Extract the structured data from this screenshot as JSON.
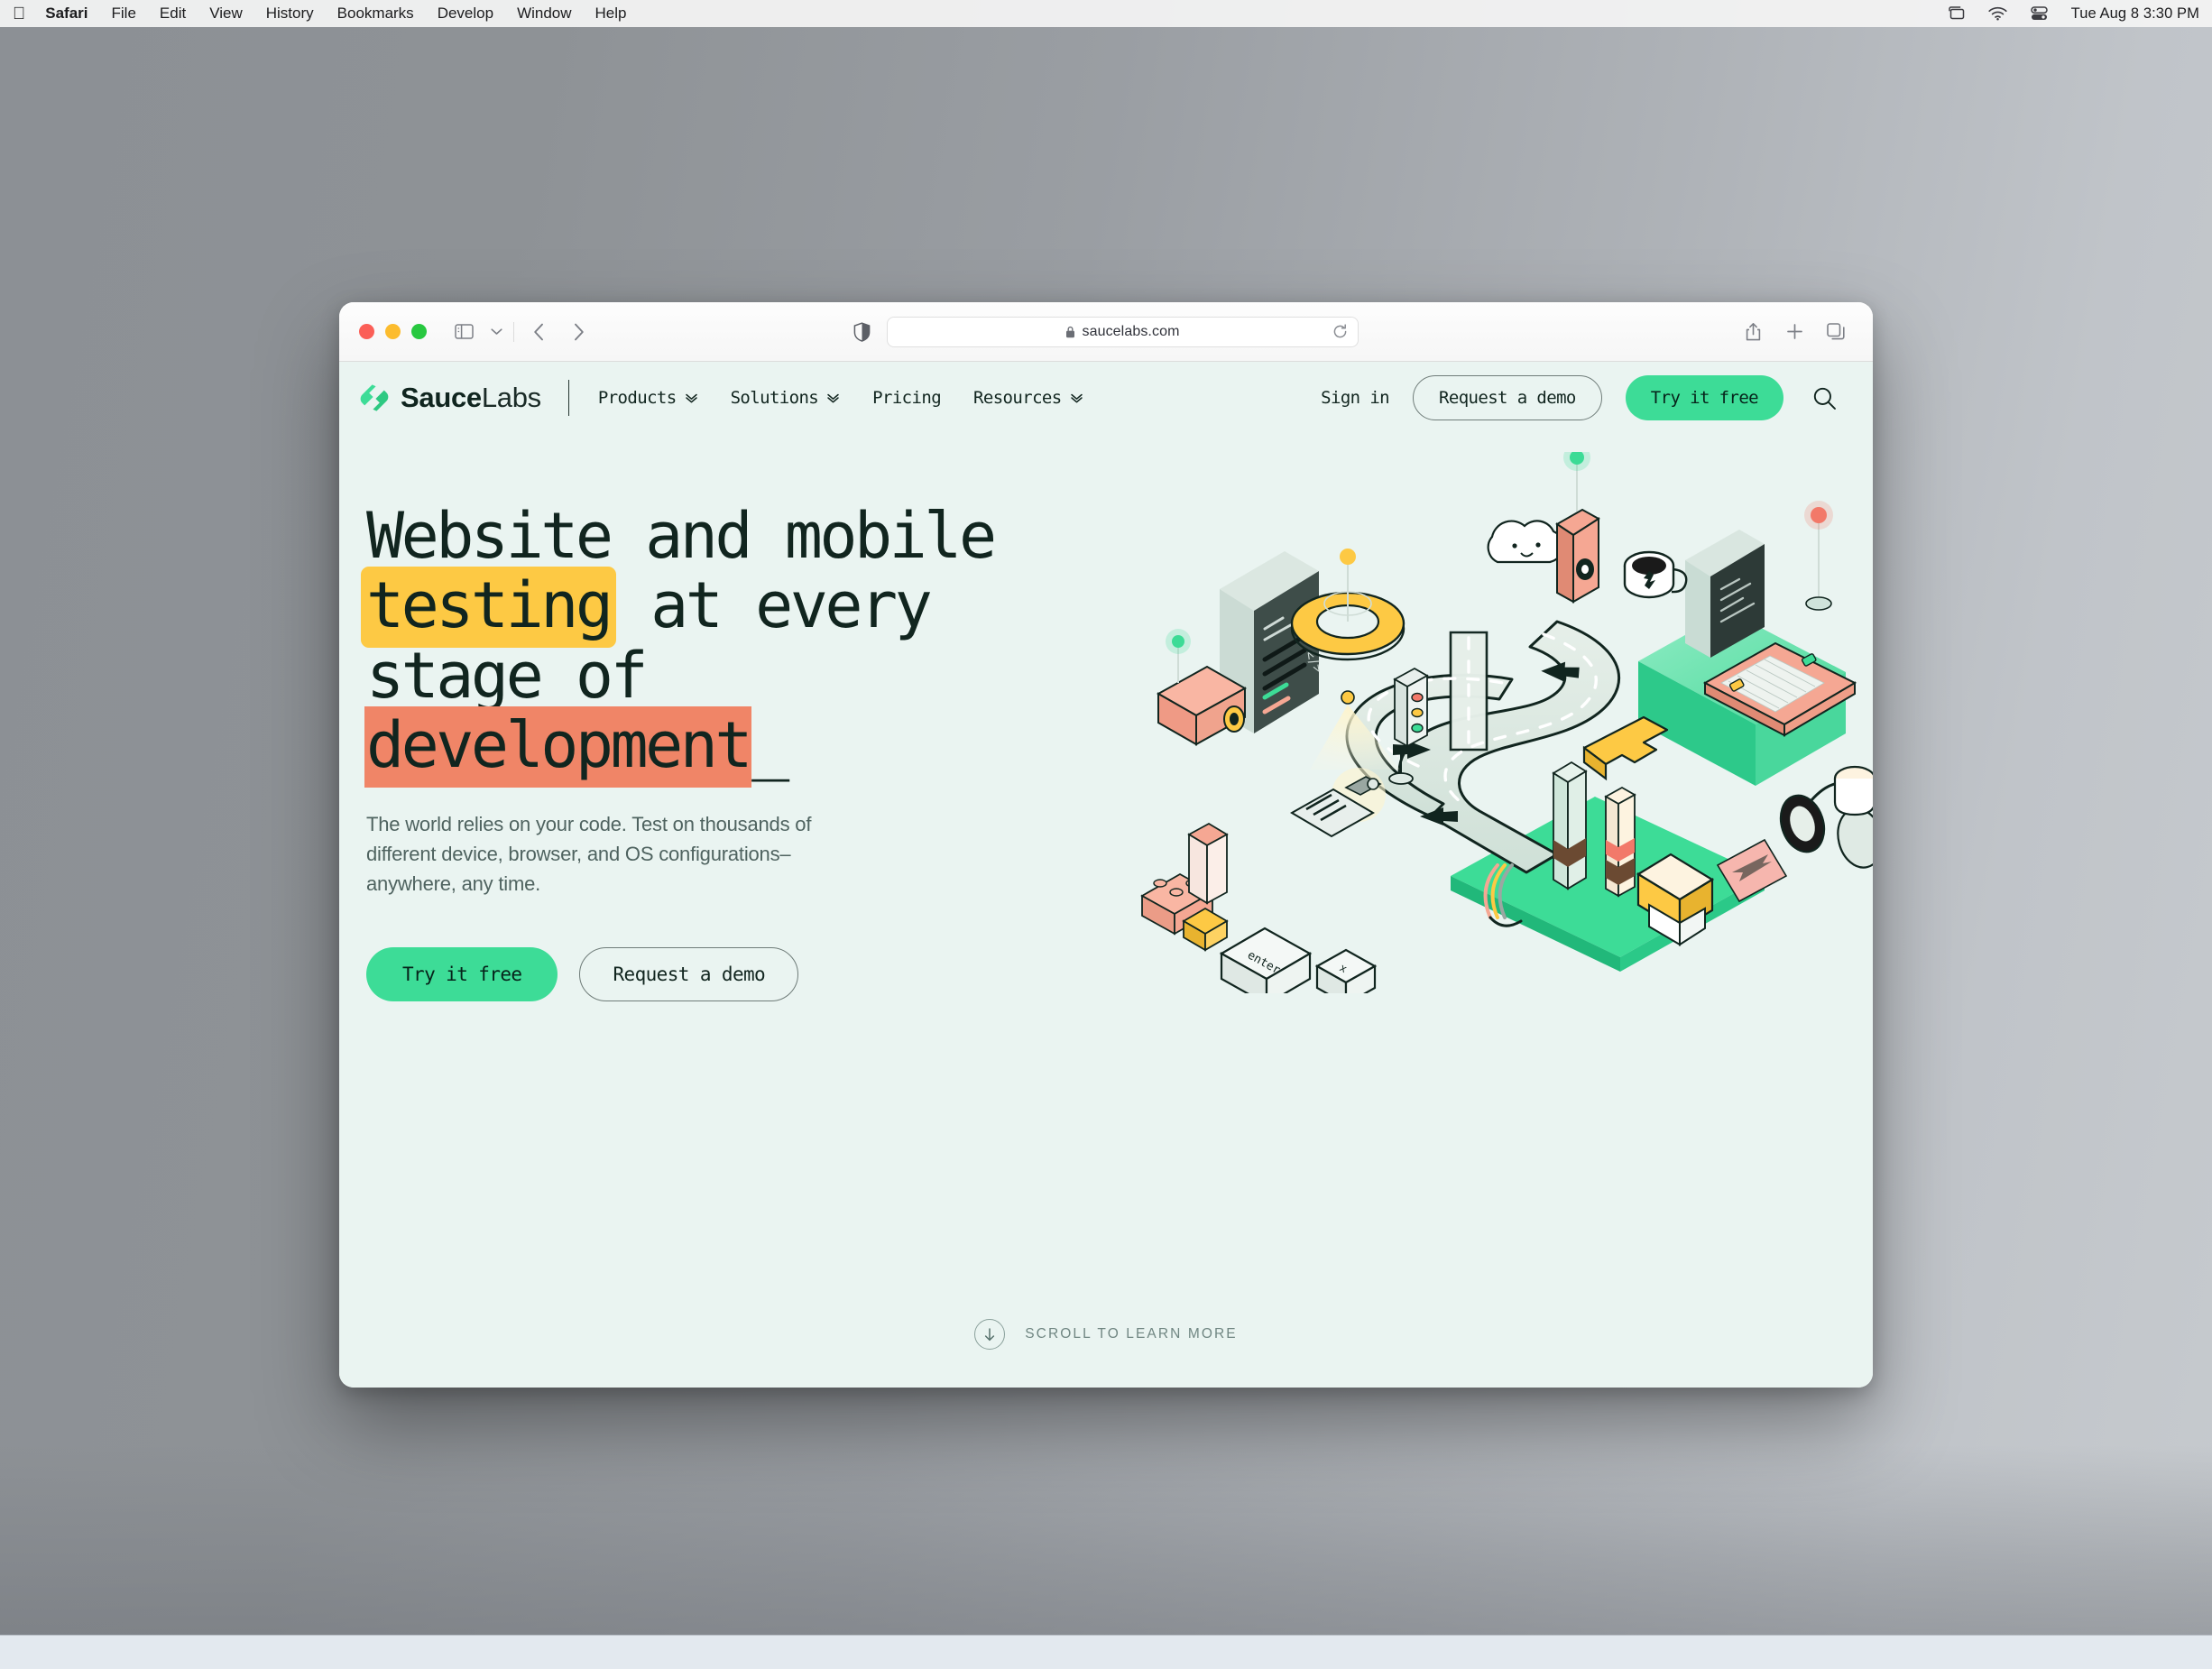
{
  "menubar": {
    "apple_icon": "apple-logo-icon",
    "items": [
      {
        "label": "Safari",
        "bold": true
      },
      {
        "label": "File"
      },
      {
        "label": "Edit"
      },
      {
        "label": "View"
      },
      {
        "label": "History"
      },
      {
        "label": "Bookmarks"
      },
      {
        "label": "Develop"
      },
      {
        "label": "Window"
      },
      {
        "label": "Help"
      }
    ],
    "status_icons": [
      "screen-mirroring-icon",
      "wifi-icon",
      "control-center-icon"
    ],
    "clock": "Tue Aug 8  3:30 PM"
  },
  "browser": {
    "traffic_lights": [
      "close-button",
      "minimize-button",
      "zoom-button"
    ],
    "sidebar_toggle": "sidebar-icon",
    "sidebar_chevron": "chevron-down-icon",
    "back": "back-arrow-icon",
    "forward": "forward-arrow-icon",
    "privacy_shield": "shield-icon",
    "url": "saucelabs.com",
    "lock": "lock-icon",
    "reload": "reload-icon",
    "share": "share-icon",
    "new_tab": "plus-icon",
    "tab_overview": "tab-overview-icon"
  },
  "site": {
    "brand": {
      "strong": "Sauce",
      "light": "Labs"
    },
    "nav_links": [
      {
        "label": "Products",
        "has_chevron": true
      },
      {
        "label": "Solutions",
        "has_chevron": true
      },
      {
        "label": "Pricing",
        "has_chevron": false
      },
      {
        "label": "Resources",
        "has_chevron": true
      }
    ],
    "sign_in": "Sign in",
    "request_demo": "Request a demo",
    "try_free": "Try it free",
    "search_icon": "search-icon",
    "hero": {
      "headline": {
        "line1": "Website and mobile",
        "line2_mark": "testing",
        "line2_rest": " at every",
        "line3": "stage of",
        "line4_mark": "development",
        "caret": "_"
      },
      "subtitle": "The world relies on your code. Test on thousands of different device, browser, and OS configurations–anywhere, any time.",
      "cta_primary": "Try it free",
      "cta_secondary": "Request a demo"
    },
    "scroll": {
      "icon": "arrow-down-icon",
      "label": "SCROLL TO LEARN MORE"
    },
    "colors": {
      "page_bg": "#eaf4f1",
      "accent_green": "#3ddc97",
      "highlight_yellow": "#fdc944",
      "highlight_orange": "#f08567",
      "ink": "#11251f",
      "muted": "#4f6360"
    },
    "illustration": {
      "name": "isometric-testing-road-illustration",
      "elements": [
        "winding-road",
        "smartphone-code-editor",
        "ring-light",
        "traffic-light",
        "cloud",
        "coffee-mug",
        "keyboard",
        "monitor",
        "headphones",
        "lego-bricks",
        "enter-key",
        "coffee-cup",
        "lipstick-towers",
        "cursor-arrow"
      ]
    }
  }
}
